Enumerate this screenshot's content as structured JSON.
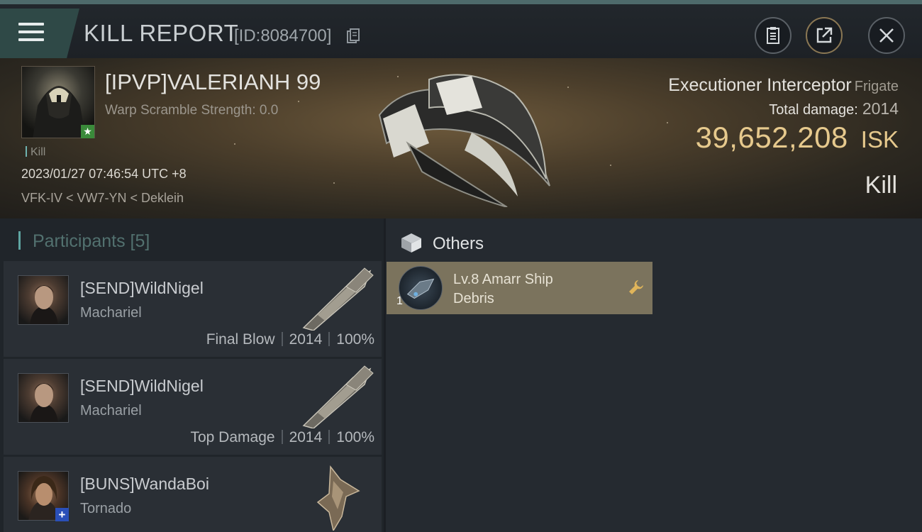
{
  "header": {
    "title": "KILL REPORT",
    "report_id": "[ID:8084700]",
    "icons": [
      "menu-icon",
      "copy-icon",
      "clipboard-icon",
      "share-icon",
      "close-icon"
    ]
  },
  "kill": {
    "pilot_name": "[IPVP]VALERIANH 99",
    "warp_scramble": "Warp Scramble Strength: 0.0",
    "tag": "Kill",
    "time": "2023/01/27 07:46:54 UTC +8",
    "location": "VFK-IV < VW7-YN < Deklein",
    "ship_name": "Executioner Interceptor",
    "ship_class": "Frigate",
    "total_damage_label": "Total damage:",
    "total_damage": "2014",
    "isk_value": "39,652,208",
    "isk_unit": "ISK",
    "result": "Kill"
  },
  "participants": {
    "label": "Participants",
    "count": "[5]",
    "rows": [
      {
        "name": "[SEND]WildNigel",
        "ship": "Machariel",
        "role": "Final Blow",
        "damage": "2014",
        "percent": "100%"
      },
      {
        "name": "[SEND]WildNigel",
        "ship": "Machariel",
        "role": "Top Damage",
        "damage": "2014",
        "percent": "100%"
      },
      {
        "name": "[BUNS]WandaBoi",
        "ship": "Tornado",
        "role": "",
        "damage": "",
        "percent": ""
      }
    ]
  },
  "others": {
    "label": "Others",
    "items": [
      {
        "line1": "Lv.8 Amarr Ship",
        "line2": "Debris",
        "qty": "1"
      }
    ]
  },
  "colors": {
    "accent_teal": "#5fa5a2",
    "isk_gold": "#e6c98d",
    "item_bg": "#7b735d"
  }
}
